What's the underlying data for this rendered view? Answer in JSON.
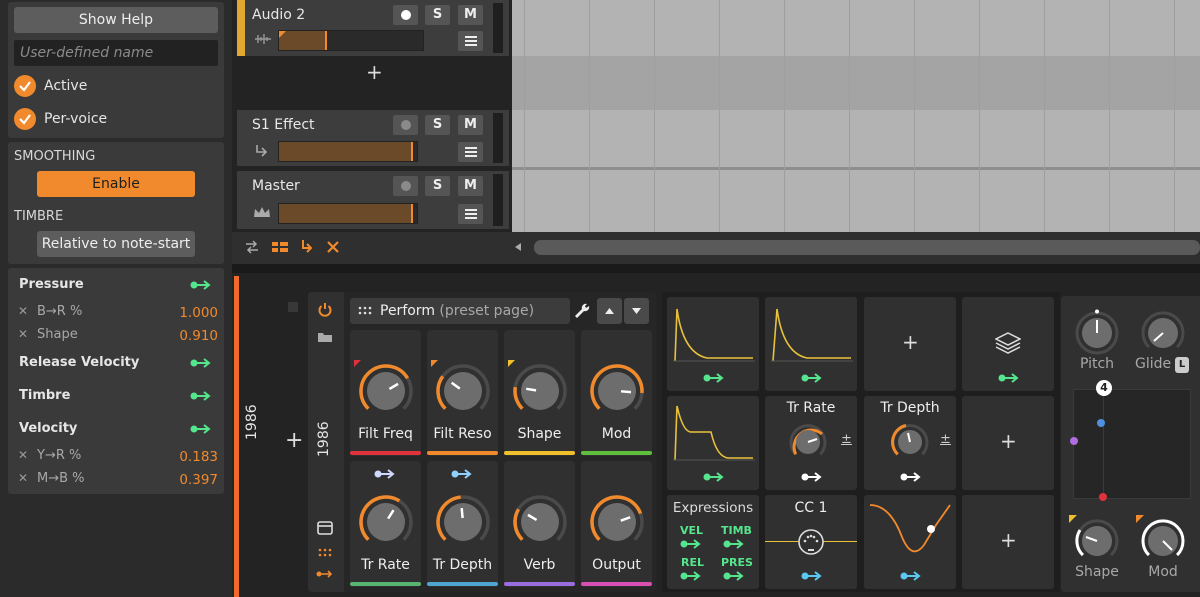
{
  "inspector": {
    "show_help": "Show Help",
    "name_placeholder": "User-defined name",
    "active_label": "Active",
    "per_voice_label": "Per-voice",
    "smoothing_title": "SMOOTHING",
    "enable_label": "Enable",
    "timbre_title": "TIMBRE",
    "relative_label": "Relative to note-start",
    "mappings": [
      {
        "label": "Pressure"
      },
      {
        "label": "B→R %",
        "value": "1.000"
      },
      {
        "label": "Shape",
        "value": "0.910"
      },
      {
        "label": "Release Velocity"
      },
      {
        "label": "Timbre"
      },
      {
        "label": "Velocity"
      },
      {
        "label": "Y→R %",
        "value": "0.183"
      },
      {
        "label": "M→B %",
        "value": "0.397"
      }
    ],
    "x_glyph": "✕"
  },
  "tracks": [
    {
      "name": "Audio 2",
      "solo": "S",
      "mute": "M",
      "fill": 0.33
    },
    {
      "name": "S1 Effect",
      "solo": "S",
      "mute": "M",
      "fill": 0.97
    },
    {
      "name": "Master",
      "solo": "S",
      "mute": "M",
      "fill": 0.97
    }
  ],
  "add_track_glyph": "+",
  "device_chain": {
    "vertical_label_1": "1986",
    "vertical_label_2": "1986",
    "add_glyph": "+"
  },
  "remote_controls": {
    "page_name": "Perform",
    "page_suffix": "(preset page)",
    "knobs": [
      {
        "label": "Filt Freq",
        "value": 0.72,
        "color": "#e0323c"
      },
      {
        "label": "Filt Reso",
        "value": 0.3,
        "color": "#f08a2c"
      },
      {
        "label": "Shape",
        "value": 0.2,
        "color": "#f0c02c"
      },
      {
        "label": "Mod",
        "value": 0.85,
        "color": "#5fbf3c"
      },
      {
        "label": "Tr Rate",
        "value": 0.62,
        "color": "#56b56e"
      },
      {
        "label": "Tr Depth",
        "value": 0.48,
        "color": "#4ea6d0"
      },
      {
        "label": "Verb",
        "value": 0.28,
        "color": "#9b6ce0"
      },
      {
        "label": "Output",
        "value": 0.76,
        "color": "#d84fb4"
      }
    ]
  },
  "modulators": {
    "tr_rate_label": "Tr Rate",
    "tr_depth_label": "Tr Depth",
    "plus_minus": "±",
    "expressions_title": "Expressions",
    "expr": [
      "VEL",
      "TIMB",
      "REL",
      "PRES"
    ],
    "cc_label": "CC 1",
    "add_glyph": "+"
  },
  "synth": {
    "pitch_label": "Pitch",
    "glide_label": "Glide",
    "glide_badge": "L",
    "xy_badge": "4",
    "shape_label": "Shape",
    "mod_label": "Mod"
  },
  "colors": {
    "accent": "#f08a2c",
    "green": "#55e58c",
    "blue": "#5ac8f0"
  }
}
